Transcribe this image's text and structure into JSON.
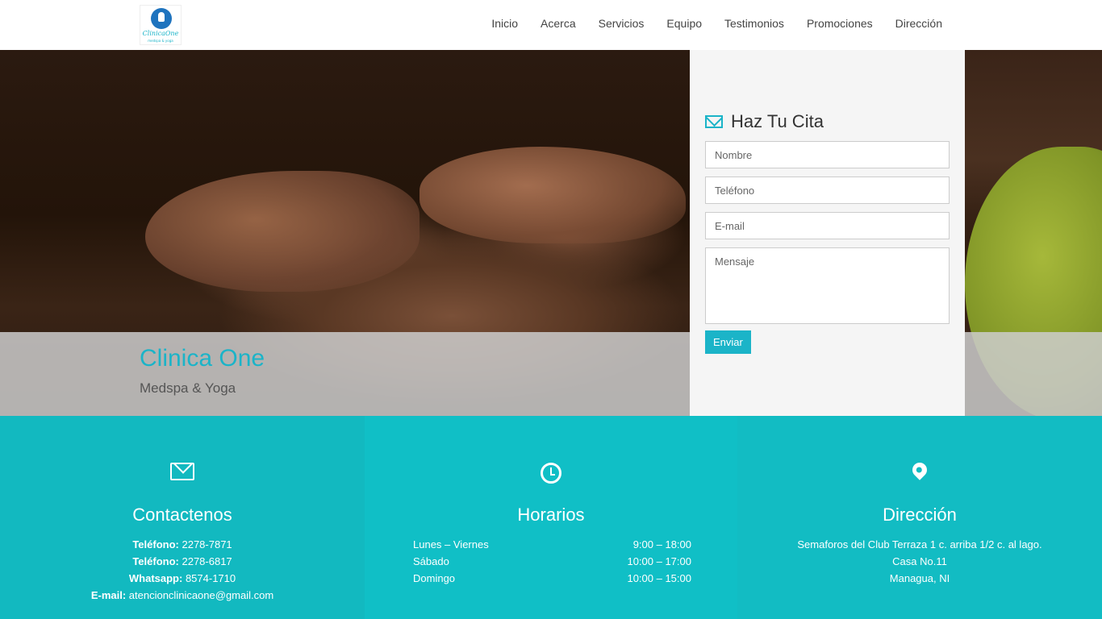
{
  "logo": {
    "text": "ClinicaOne",
    "sub": "medspa & yoga"
  },
  "nav": {
    "items": [
      {
        "label": "Inicio"
      },
      {
        "label": "Acerca"
      },
      {
        "label": "Servicios"
      },
      {
        "label": "Equipo"
      },
      {
        "label": "Testimonios"
      },
      {
        "label": "Promociones"
      },
      {
        "label": "Dirección"
      }
    ]
  },
  "hero": {
    "title": "Clinica One",
    "subtitle": "Medspa & Yoga"
  },
  "form": {
    "title": "Haz Tu Cita",
    "name_placeholder": "Nombre",
    "phone_placeholder": "Teléfono",
    "email_placeholder": "E-mail",
    "message_placeholder": "Mensaje",
    "submit_label": "Enviar"
  },
  "contact": {
    "heading": "Contactenos",
    "lines": [
      {
        "label": "Teléfono:",
        "value": "2278-7871"
      },
      {
        "label": "Teléfono:",
        "value": "2278-6817"
      },
      {
        "label": "Whatsapp:",
        "value": "8574-1710"
      },
      {
        "label": "E-mail:",
        "value": "atencionclinicaone@gmail.com"
      }
    ]
  },
  "hours": {
    "heading": "Horarios",
    "rows": [
      {
        "day": "Lunes – Viernes",
        "time": "9:00 – 18:00"
      },
      {
        "day": "Sábado",
        "time": "10:00 – 17:00"
      },
      {
        "day": "Domingo",
        "time": "10:00 – 15:00"
      }
    ]
  },
  "address": {
    "heading": "Dirección",
    "lines": [
      "Semaforos del Club Terraza 1 c. arriba 1/2 c. al lago.",
      "Casa No.11",
      "Managua, NI"
    ]
  },
  "colors": {
    "accent": "#1bb4c8",
    "band": "#0fbdc4"
  }
}
